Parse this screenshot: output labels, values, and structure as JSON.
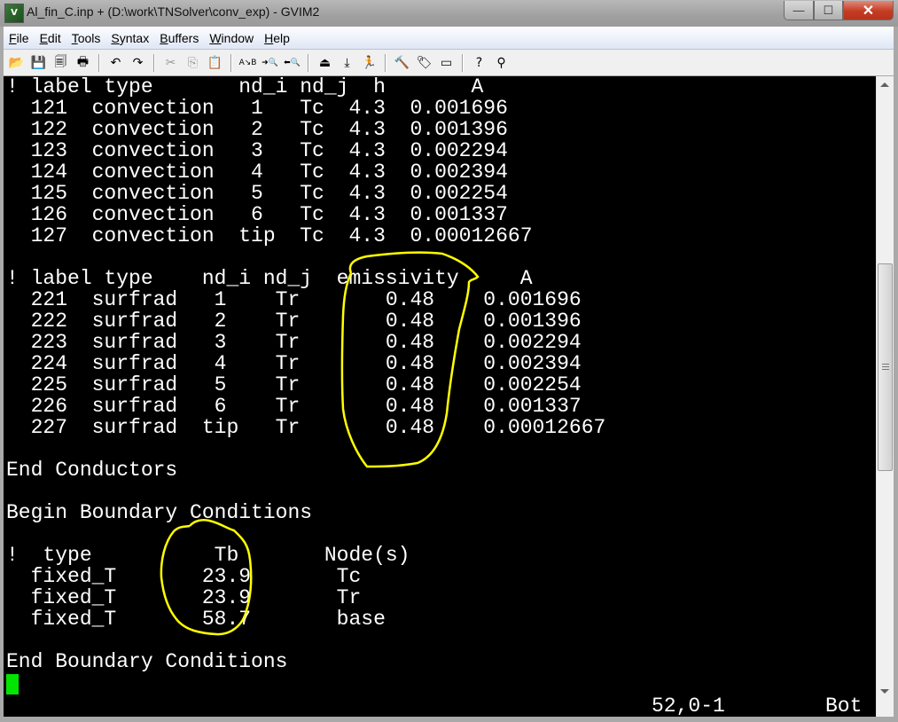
{
  "window": {
    "title": "Al_fin_C.inp + (D:\\work\\TNSolver\\conv_exp) - GVIM2",
    "app_icon": "vim-icon",
    "controls": {
      "minimize": "—",
      "maximize": "☐",
      "close": "✕"
    }
  },
  "menu": [
    {
      "label": "File",
      "accel": "F"
    },
    {
      "label": "Edit",
      "accel": "E"
    },
    {
      "label": "Tools",
      "accel": "T"
    },
    {
      "label": "Syntax",
      "accel": "S"
    },
    {
      "label": "Buffers",
      "accel": "B"
    },
    {
      "label": "Window",
      "accel": "W"
    },
    {
      "label": "Help",
      "accel": "H"
    }
  ],
  "toolbar": [
    {
      "name": "open-icon",
      "glyph": "📂"
    },
    {
      "name": "save-icon",
      "glyph": "💾"
    },
    {
      "name": "save-all-icon",
      "glyph": "🗐"
    },
    {
      "name": "print-icon",
      "glyph": "🖶"
    },
    {
      "sep": true
    },
    {
      "name": "undo-icon",
      "glyph": "↶"
    },
    {
      "name": "redo-icon",
      "glyph": "↷"
    },
    {
      "sep": true
    },
    {
      "name": "cut-icon",
      "glyph": "✂",
      "disabled": true
    },
    {
      "name": "copy-icon",
      "glyph": "⎘",
      "disabled": true
    },
    {
      "name": "paste-icon",
      "glyph": "📋"
    },
    {
      "sep": true
    },
    {
      "name": "replace-icon",
      "glyph": "A↘B"
    },
    {
      "name": "find-next-icon",
      "glyph": "➜🔍"
    },
    {
      "name": "find-prev-icon",
      "glyph": "⬅🔍"
    },
    {
      "sep": true
    },
    {
      "name": "load-session-icon",
      "glyph": "⏏"
    },
    {
      "name": "save-session-icon",
      "glyph": "⤓"
    },
    {
      "name": "run-script-icon",
      "glyph": "🏃"
    },
    {
      "sep": true
    },
    {
      "name": "make-icon",
      "glyph": "🔨"
    },
    {
      "name": "build-tags-icon",
      "glyph": "🏷"
    },
    {
      "name": "jump-tag-icon",
      "glyph": "▭"
    },
    {
      "sep": true
    },
    {
      "name": "help-icon",
      "glyph": "?"
    },
    {
      "name": "find-help-icon",
      "glyph": "⚲"
    }
  ],
  "editor": {
    "lines": [
      "! label type       nd_i nd_j  h       A",
      "  121  convection   1   Tc  4.3  0.001696",
      "  122  convection   2   Tc  4.3  0.001396",
      "  123  convection   3   Tc  4.3  0.002294",
      "  124  convection   4   Tc  4.3  0.002394",
      "  125  convection   5   Tc  4.3  0.002254",
      "  126  convection   6   Tc  4.3  0.001337",
      "  127  convection  tip  Tc  4.3  0.00012667",
      "",
      "! label type    nd_i nd_j  emissivity     A",
      "  221  surfrad   1    Tr       0.48    0.001696",
      "  222  surfrad   2    Tr       0.48    0.001396",
      "  223  surfrad   3    Tr       0.48    0.002294",
      "  224  surfrad   4    Tr       0.48    0.002394",
      "  225  surfrad   5    Tr       0.48    0.002254",
      "  226  surfrad   6    Tr       0.48    0.001337",
      "  227  surfrad  tip   Tr       0.48    0.00012667",
      "",
      "End Conductors",
      "",
      "Begin Boundary Conditions",
      "",
      "!  type          Tb       Node(s)",
      "  fixed_T       23.9       Tc",
      "  fixed_T       23.9       Tr",
      "  fixed_T       58.7       base",
      "",
      "End Boundary Conditions"
    ],
    "cursor_color": "#00e400",
    "ruler": {
      "position": "52,0-1",
      "scroll": "Bot"
    },
    "annotation_color": "#ffff00"
  },
  "scrollbar": {
    "position_fraction": 1.0
  }
}
